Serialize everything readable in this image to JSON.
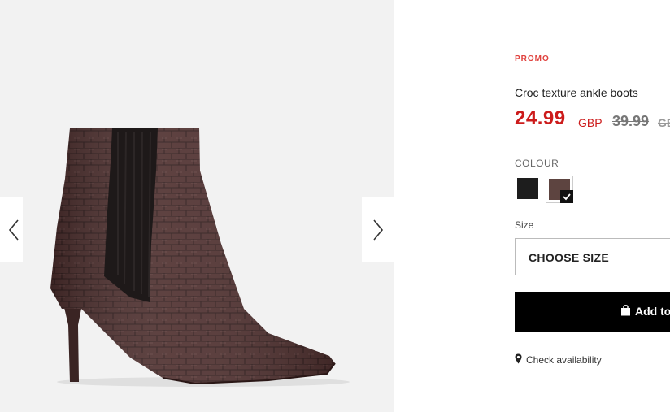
{
  "product": {
    "badge": "PROMO",
    "title": "Croc texture ankle boots",
    "price": "24.99",
    "currency": "GBP",
    "old_price": "39.99",
    "old_currency": "GBP"
  },
  "colour": {
    "label": "COLOUR",
    "options": [
      {
        "name": "black",
        "hex": "#1d1d1d",
        "selected": false
      },
      {
        "name": "brown",
        "hex": "#5d4440",
        "selected": true
      }
    ]
  },
  "size": {
    "label": "Size",
    "placeholder": "CHOOSE SIZE"
  },
  "cart": {
    "add_label": "Add to"
  },
  "availability": {
    "label": "Check availability"
  },
  "gallery": {
    "prev_icon": "chevron-left-icon",
    "next_icon": "chevron-right-icon"
  },
  "colors": {
    "accent_red": "#cc1b1b",
    "promo_red": "#e0413d",
    "button_black": "#000000"
  }
}
